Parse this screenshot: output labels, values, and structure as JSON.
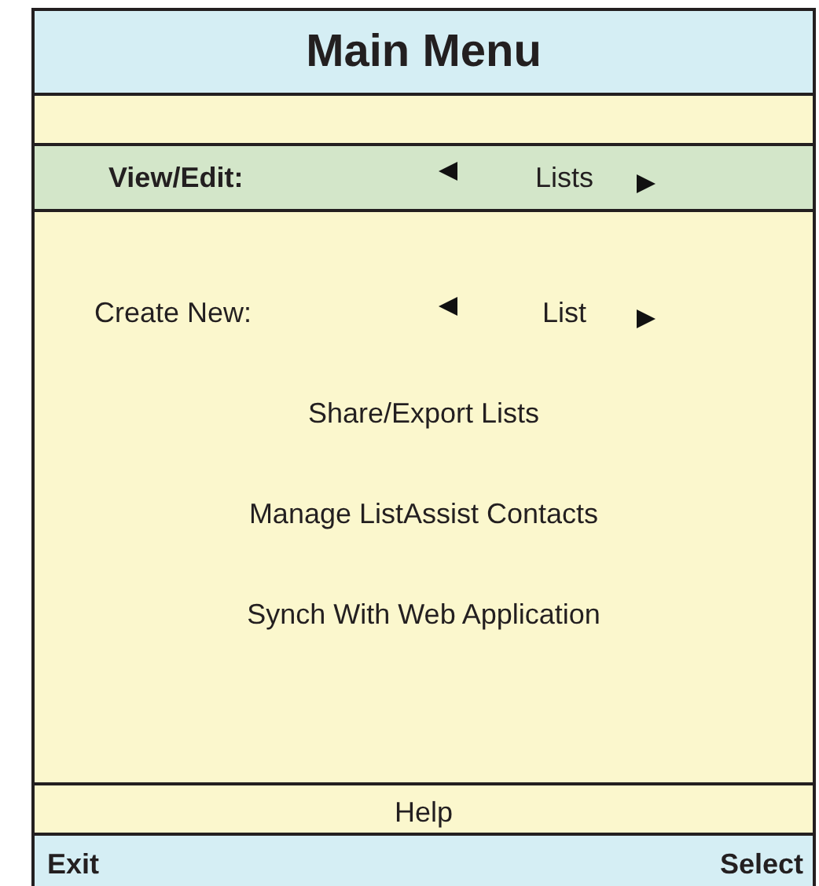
{
  "title": "Main Menu",
  "menu_items": [
    {
      "kind": "selector",
      "label": "View/Edit:",
      "value": "Lists",
      "selected": true
    },
    {
      "kind": "selector",
      "label": "Create New:",
      "value": "List",
      "selected": false
    },
    {
      "kind": "item",
      "label": "Share/Export Lists",
      "selected": false
    },
    {
      "kind": "item",
      "label": "Manage ListAssist Contacts",
      "selected": false
    },
    {
      "kind": "item",
      "label": "Synch With Web Application",
      "selected": false
    }
  ],
  "help": "Help",
  "softkeys": {
    "left": "Exit",
    "right": "Select"
  }
}
